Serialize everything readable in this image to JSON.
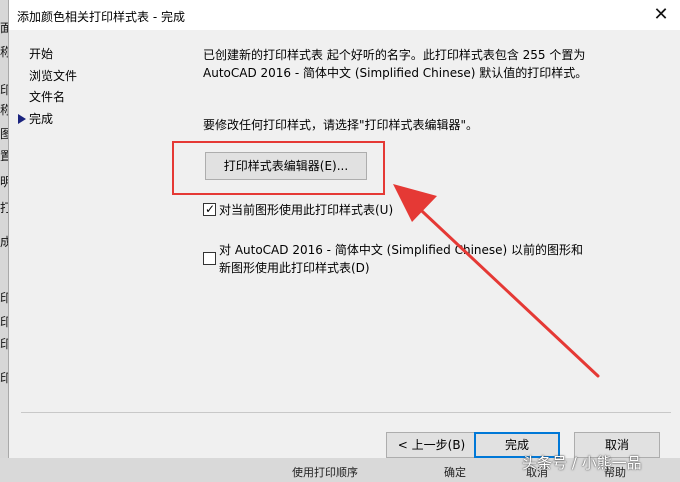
{
  "background": {
    "left_fragments": [
      "面",
      "称",
      "印",
      "称",
      "图",
      "置",
      "明",
      "打",
      "成",
      "印",
      "印",
      "印",
      "印"
    ],
    "bottom_items": [
      "使用打印顺序",
      "确定",
      "取消",
      "帮助"
    ]
  },
  "dialog": {
    "title": "添加颜色相关打印样式表 - 完成",
    "close_symbol": "✕",
    "nav": [
      {
        "label": "开始"
      },
      {
        "label": "浏览文件"
      },
      {
        "label": "文件名"
      },
      {
        "label": "完成"
      }
    ],
    "current_step": "完成",
    "message_line1": "已创建新的打印样式表 起个好听的名字。此打印样式表包含 255 个置为",
    "message_line2": "AutoCAD 2016 - 简体中文 (Simplified Chinese) 默认值的打印样式。",
    "instruction": "要修改任何打印样式，请选择\"打印样式表编辑器\"。",
    "editor_button": "打印样式表编辑器(E)...",
    "checkbox1": {
      "label": "对当前图形使用此打印样式表(U)",
      "checked": true
    },
    "checkbox2": {
      "label_line1": "对 AutoCAD 2016 - 简体中文 (Simplified Chinese) 以前的图形和",
      "label_line2": "新图形使用此打印样式表(D)",
      "checked": false
    },
    "buttons": {
      "back": "< 上一步(B)",
      "finish": "完成",
      "cancel": "取消"
    }
  },
  "watermark": "头条号 / 小熊一品",
  "colors": {
    "highlight": "#e53935",
    "accent": "#0078d7"
  }
}
